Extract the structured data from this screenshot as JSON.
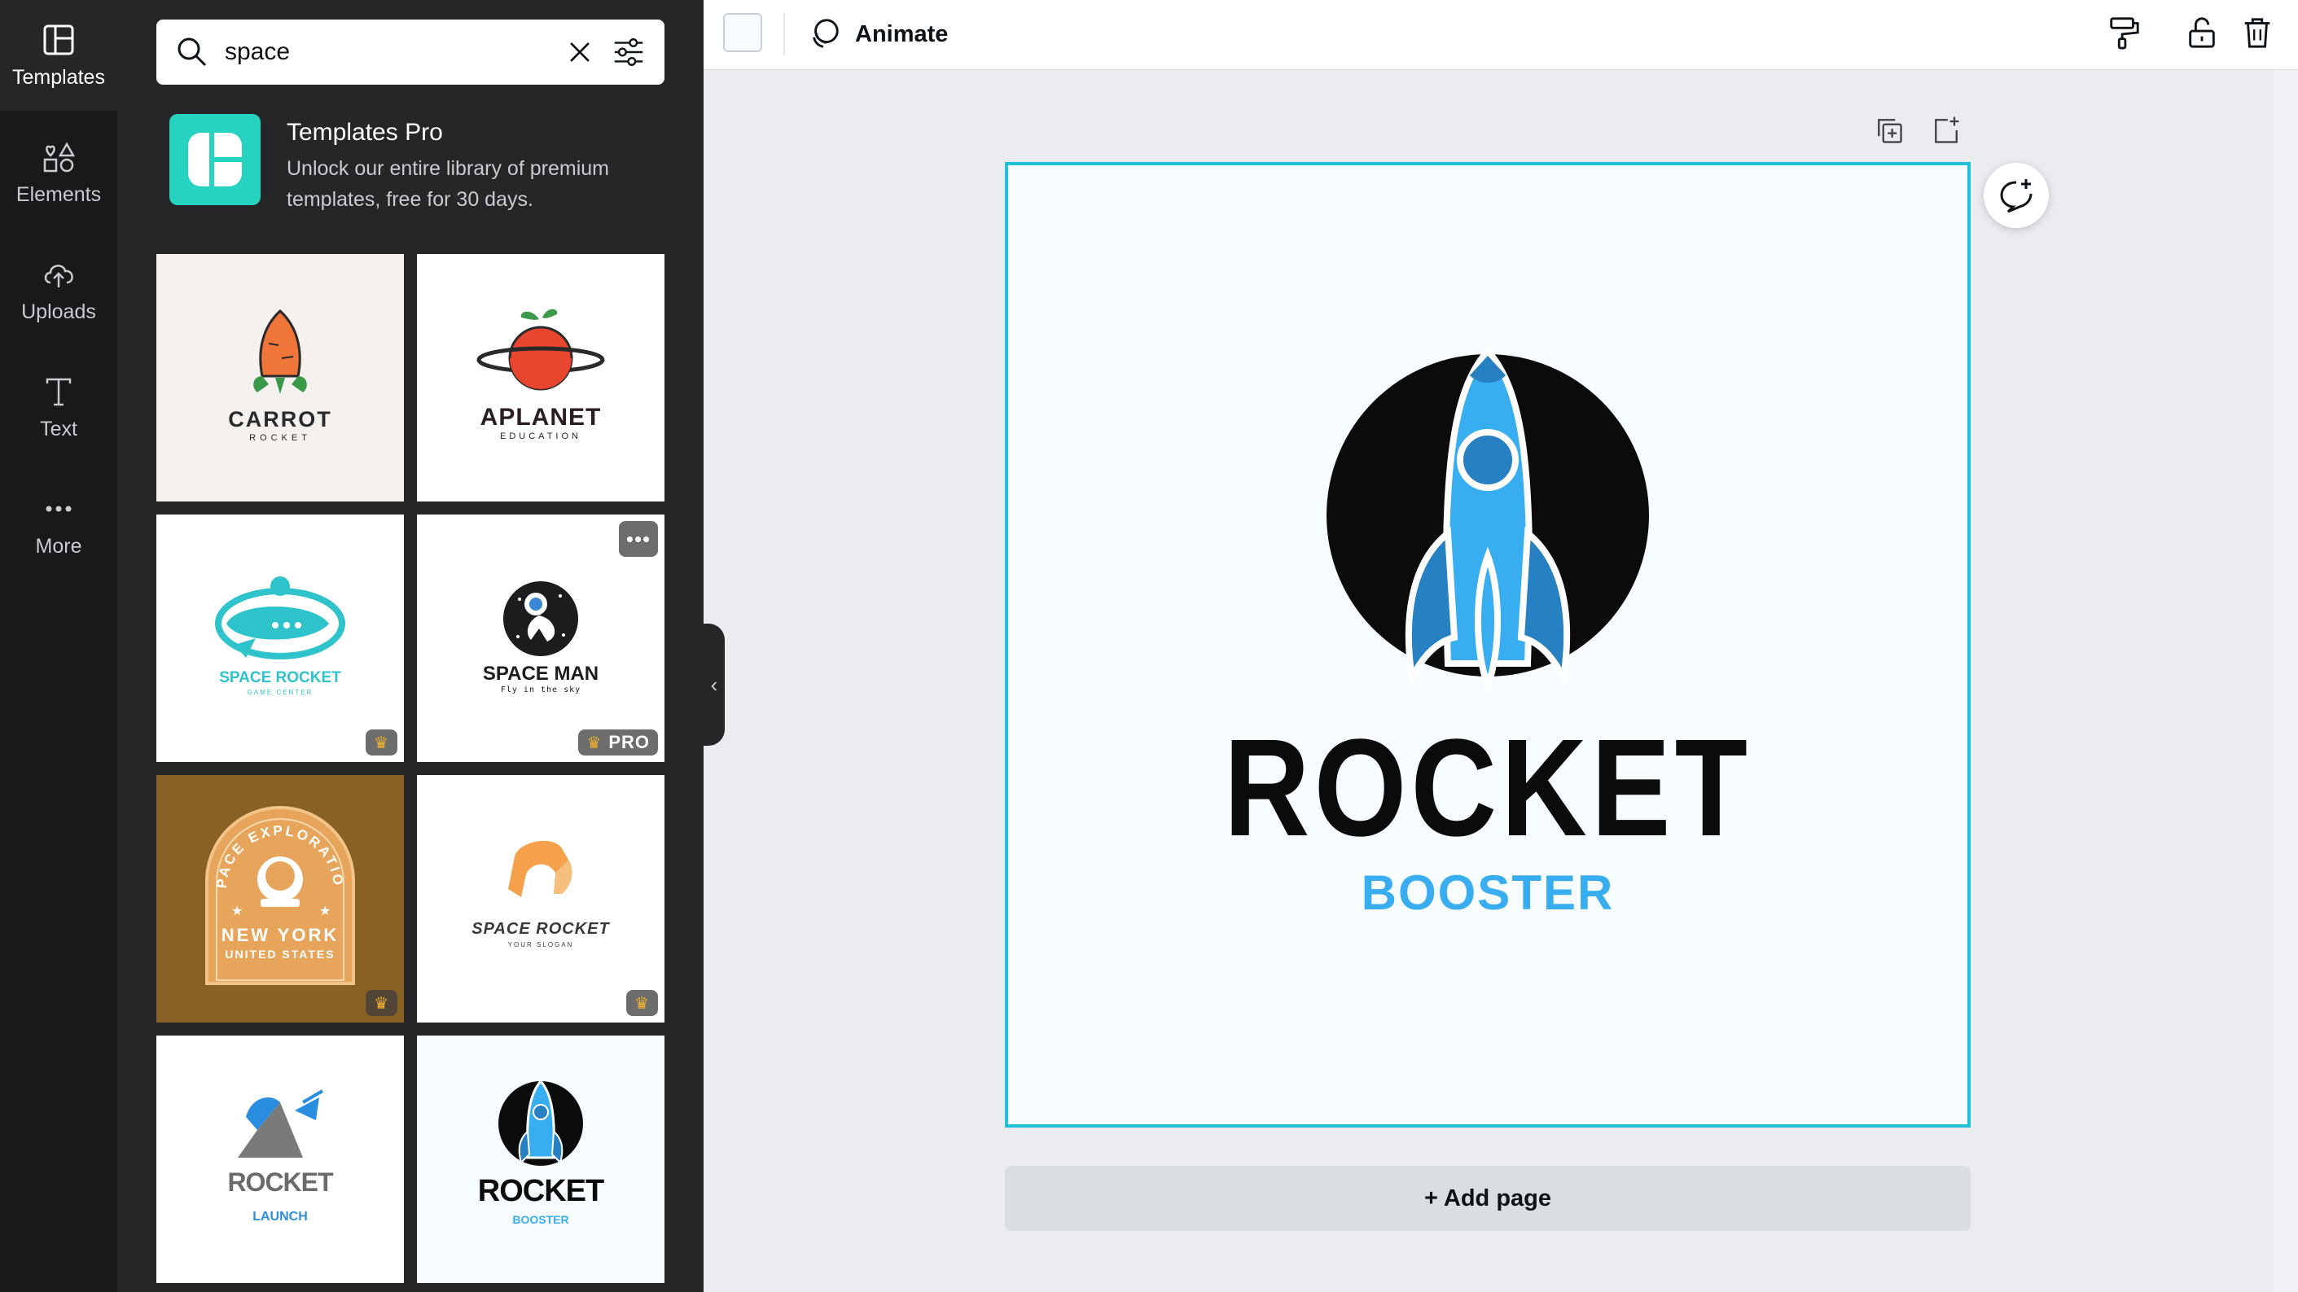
{
  "rail": {
    "items": [
      {
        "label": "Templates",
        "icon": "templates-icon"
      },
      {
        "label": "Elements",
        "icon": "elements-icon"
      },
      {
        "label": "Uploads",
        "icon": "uploads-icon"
      },
      {
        "label": "Text",
        "icon": "text-icon"
      },
      {
        "label": "More",
        "icon": "more-icon"
      }
    ]
  },
  "search": {
    "value": "space",
    "clear_icon": "close-icon",
    "filter_icon": "filter-icon"
  },
  "promo": {
    "title": "Templates Pro",
    "description": "Unlock our entire library of premium templates, free for 30 days."
  },
  "templates": [
    {
      "title": "CARROT",
      "subtitle": "ROCKET",
      "bg": "#f4f1ee",
      "badge": ""
    },
    {
      "title": "APLANET",
      "subtitle": "EDUCATION",
      "bg": "#ffffff",
      "badge": ""
    },
    {
      "title": "SPACE ROCKET",
      "subtitle": "GAME CENTER",
      "bg": "#ffffff",
      "badge": "crown"
    },
    {
      "title": "SPACE MAN",
      "subtitle": "Fly in the sky",
      "bg": "#ffffff",
      "badge": "PRO"
    },
    {
      "title": "NEW YORK",
      "subtitle": "UNITED STATES",
      "arc": "SPACE EXPLORATION",
      "bg": "#8a6124",
      "badge": "crown"
    },
    {
      "title": "SPACE ROCKET",
      "subtitle": "YOUR SLOGAN",
      "bg": "#ffffff",
      "badge": "crown"
    },
    {
      "title": "ROCKET",
      "subtitle": "LAUNCH",
      "bg": "#ffffff",
      "badge": ""
    },
    {
      "title": "ROCKET",
      "subtitle": "BOOSTER",
      "bg": "#f7fcff",
      "badge": ""
    }
  ],
  "toolbar": {
    "animate_label": "Animate",
    "swatch_color": "#f7fcff"
  },
  "canvas": {
    "title": "ROCKET",
    "subtitle": "BOOSTER",
    "accent": "#38aef0",
    "border": "#1fc0d8"
  },
  "add_page_label": "+ Add page"
}
